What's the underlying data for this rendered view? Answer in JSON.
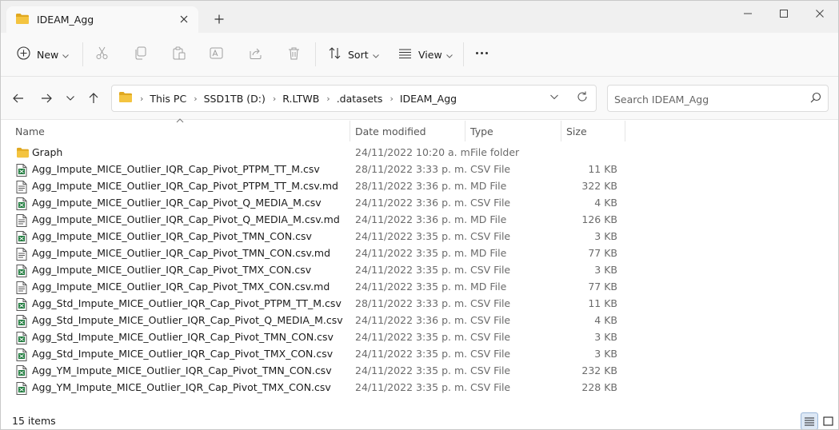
{
  "tab": {
    "title": "IDEAM_Agg"
  },
  "commands": {
    "new_label": "New",
    "sort_label": "Sort",
    "view_label": "View"
  },
  "breadcrumb": [
    "This PC",
    "SSD1TB (D:)",
    "R.LTWB",
    ".datasets",
    "IDEAM_Agg"
  ],
  "search": {
    "placeholder": "Search IDEAM_Agg"
  },
  "columns": {
    "name": "Name",
    "date": "Date modified",
    "type": "Type",
    "size": "Size"
  },
  "files": [
    {
      "name": "Graph",
      "date": "24/11/2022 10:20 a. m.",
      "type": "File folder",
      "size": "",
      "kind": "folder"
    },
    {
      "name": "Agg_Impute_MICE_Outlier_IQR_Cap_Pivot_PTPM_TT_M.csv",
      "date": "28/11/2022 3:33 p. m.",
      "type": "CSV File",
      "size": "11 KB",
      "kind": "csv"
    },
    {
      "name": "Agg_Impute_MICE_Outlier_IQR_Cap_Pivot_PTPM_TT_M.csv.md",
      "date": "28/11/2022 3:36 p. m.",
      "type": "MD File",
      "size": "322 KB",
      "kind": "md"
    },
    {
      "name": "Agg_Impute_MICE_Outlier_IQR_Cap_Pivot_Q_MEDIA_M.csv",
      "date": "24/11/2022 3:36 p. m.",
      "type": "CSV File",
      "size": "4 KB",
      "kind": "csv"
    },
    {
      "name": "Agg_Impute_MICE_Outlier_IQR_Cap_Pivot_Q_MEDIA_M.csv.md",
      "date": "24/11/2022 3:36 p. m.",
      "type": "MD File",
      "size": "126 KB",
      "kind": "md"
    },
    {
      "name": "Agg_Impute_MICE_Outlier_IQR_Cap_Pivot_TMN_CON.csv",
      "date": "24/11/2022 3:35 p. m.",
      "type": "CSV File",
      "size": "3 KB",
      "kind": "csv"
    },
    {
      "name": "Agg_Impute_MICE_Outlier_IQR_Cap_Pivot_TMN_CON.csv.md",
      "date": "24/11/2022 3:35 p. m.",
      "type": "MD File",
      "size": "77 KB",
      "kind": "md"
    },
    {
      "name": "Agg_Impute_MICE_Outlier_IQR_Cap_Pivot_TMX_CON.csv",
      "date": "24/11/2022 3:35 p. m.",
      "type": "CSV File",
      "size": "3 KB",
      "kind": "csv"
    },
    {
      "name": "Agg_Impute_MICE_Outlier_IQR_Cap_Pivot_TMX_CON.csv.md",
      "date": "24/11/2022 3:35 p. m.",
      "type": "MD File",
      "size": "77 KB",
      "kind": "md"
    },
    {
      "name": "Agg_Std_Impute_MICE_Outlier_IQR_Cap_Pivot_PTPM_TT_M.csv",
      "date": "28/11/2022 3:33 p. m.",
      "type": "CSV File",
      "size": "11 KB",
      "kind": "csv"
    },
    {
      "name": "Agg_Std_Impute_MICE_Outlier_IQR_Cap_Pivot_Q_MEDIA_M.csv",
      "date": "24/11/2022 3:36 p. m.",
      "type": "CSV File",
      "size": "4 KB",
      "kind": "csv"
    },
    {
      "name": "Agg_Std_Impute_MICE_Outlier_IQR_Cap_Pivot_TMN_CON.csv",
      "date": "24/11/2022 3:35 p. m.",
      "type": "CSV File",
      "size": "3 KB",
      "kind": "csv"
    },
    {
      "name": "Agg_Std_Impute_MICE_Outlier_IQR_Cap_Pivot_TMX_CON.csv",
      "date": "24/11/2022 3:35 p. m.",
      "type": "CSV File",
      "size": "3 KB",
      "kind": "csv"
    },
    {
      "name": "Agg_YM_Impute_MICE_Outlier_IQR_Cap_Pivot_TMN_CON.csv",
      "date": "24/11/2022 3:35 p. m.",
      "type": "CSV File",
      "size": "232 KB",
      "kind": "csv"
    },
    {
      "name": "Agg_YM_Impute_MICE_Outlier_IQR_Cap_Pivot_TMX_CON.csv",
      "date": "24/11/2022 3:35 p. m.",
      "type": "CSV File",
      "size": "228 KB",
      "kind": "csv"
    }
  ],
  "status": {
    "count": "15 items"
  },
  "colors": {
    "folder": "#f4c440",
    "folder_dark": "#e0a820",
    "accent": "#0067c0"
  }
}
